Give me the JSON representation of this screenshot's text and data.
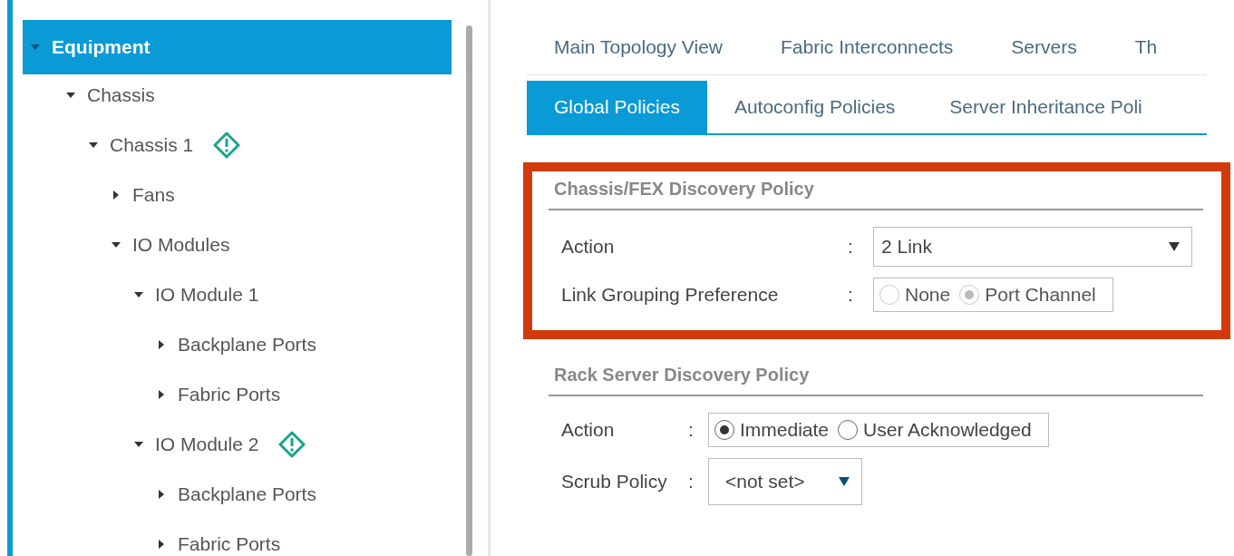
{
  "tree": [
    {
      "label": "Equipment",
      "expanded": true,
      "selected": true,
      "alert": false,
      "children": [
        {
          "label": "Chassis",
          "expanded": true,
          "selected": false,
          "alert": false,
          "children": [
            {
              "label": "Chassis 1",
              "expanded": true,
              "selected": false,
              "alert": true,
              "children": [
                {
                  "label": "Fans",
                  "expanded": false,
                  "selected": false,
                  "alert": false
                },
                {
                  "label": "IO Modules",
                  "expanded": true,
                  "selected": false,
                  "alert": false,
                  "children": [
                    {
                      "label": "IO Module 1",
                      "expanded": true,
                      "selected": false,
                      "alert": false,
                      "children": [
                        {
                          "label": "Backplane Ports",
                          "expanded": false,
                          "selected": false,
                          "alert": false
                        },
                        {
                          "label": "Fabric Ports",
                          "expanded": false,
                          "selected": false,
                          "alert": false
                        }
                      ]
                    },
                    {
                      "label": "IO Module 2",
                      "expanded": true,
                      "selected": false,
                      "alert": true,
                      "children": [
                        {
                          "label": "Backplane Ports",
                          "expanded": false,
                          "selected": false,
                          "alert": false
                        },
                        {
                          "label": "Fabric Ports",
                          "expanded": false,
                          "selected": false,
                          "alert": false
                        }
                      ]
                    }
                  ]
                }
              ]
            }
          ]
        }
      ]
    }
  ],
  "top_tabs": [
    {
      "label": "Main Topology View",
      "selected": false
    },
    {
      "label": "Fabric Interconnects",
      "selected": false
    },
    {
      "label": "Servers",
      "selected": false
    },
    {
      "label": "Th",
      "selected": false
    }
  ],
  "sub_tabs": [
    {
      "label": "Global Policies",
      "selected": true
    },
    {
      "label": "Autoconfig Policies",
      "selected": false
    },
    {
      "label": "Server Inheritance Poli",
      "selected": false
    }
  ],
  "sections": [
    {
      "title": "Chassis/FEX Discovery Policy",
      "highlighted": true,
      "fields": [
        {
          "kind": "select",
          "label": "Action",
          "separator": ":",
          "value": "2 Link",
          "wide": true
        },
        {
          "kind": "radio",
          "label": "Link Grouping Preference",
          "separator": ":",
          "disabled": true,
          "options": [
            {
              "label": "None",
              "selected": false
            },
            {
              "label": "Port Channel",
              "selected": true
            }
          ]
        }
      ]
    },
    {
      "title": "Rack Server Discovery Policy",
      "highlighted": false,
      "fields": [
        {
          "kind": "radio",
          "label": "Action",
          "separator": ":",
          "disabled": false,
          "options": [
            {
              "label": "Immediate",
              "selected": true
            },
            {
              "label": "User Acknowledged",
              "selected": false
            }
          ]
        },
        {
          "kind": "select",
          "label": "Scrub Policy",
          "separator": ":",
          "value": "<not set>",
          "wide": false
        }
      ]
    }
  ]
}
